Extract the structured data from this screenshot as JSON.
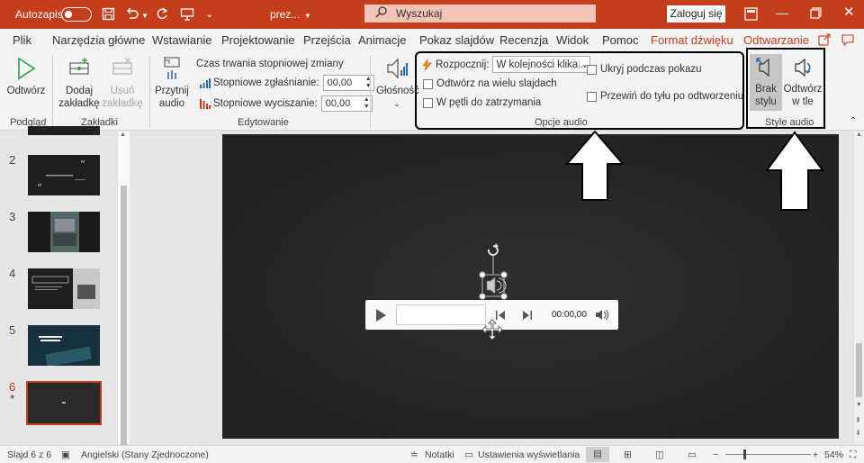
{
  "titlebar": {
    "autosave_label": "Autozapis",
    "filename": "prez...",
    "search_placeholder": "Wyszukaj",
    "login_label": "Zaloguj się"
  },
  "tabs": [
    "Plik",
    "Narzędzia główne",
    "Wstawianie",
    "Projektowanie",
    "Przejścia",
    "Animacje",
    "Pokaz slajdów",
    "Recenzja",
    "Widok",
    "Pomoc",
    "Format dźwięku",
    "Odtwarzanie"
  ],
  "ribbon": {
    "preview": {
      "play_label": "Odtwórz",
      "group": "Podgląd"
    },
    "bookmarks": {
      "add_label_1": "Dodaj",
      "add_label_2": "zakładkę",
      "remove_label_1": "Usuń",
      "remove_label_2": "zakładkę",
      "group": "Zakładki"
    },
    "editing": {
      "trim_label_1": "Przytnij",
      "trim_label_2": "audio",
      "fade_title": "Czas trwania stopniowej zmiany",
      "fade_in_label": "Stopniowe zgłaśnianie:",
      "fade_in_value": "00,00",
      "fade_out_label": "Stopniowe wyciszanie:",
      "fade_out_value": "00,00",
      "group": "Edytowanie"
    },
    "audio_options": {
      "volume_label": "Głośność",
      "start_label": "Rozpocznij:",
      "start_value": "W kolejności klika...",
      "play_across_slides": "Odtwórz na wielu slajdach",
      "loop_until_stopped": "W pętli do zatrzymania",
      "hide_during_show": "Ukryj podczas pokazu",
      "rewind_after_playing": "Przewiń do tyłu po odtworzeniu",
      "group": "Opcje audio"
    },
    "audio_styles": {
      "no_style_1": "Brak",
      "no_style_2": "stylu",
      "play_bg_1": "Odtwórz",
      "play_bg_2": "w tle",
      "group": "Style audio"
    }
  },
  "slides": [
    "2",
    "3",
    "4",
    "5",
    "6"
  ],
  "player": {
    "time": "00:00,00"
  },
  "statusbar": {
    "slide_info": "Slajd 6 z 6",
    "language": "Angielski (Stany Zjednoczone)",
    "notes_label": "Notatki",
    "display_settings_label": "Ustawienia wyświetlania",
    "zoom": "54%"
  },
  "colors": {
    "accent": "#c43e1c"
  }
}
